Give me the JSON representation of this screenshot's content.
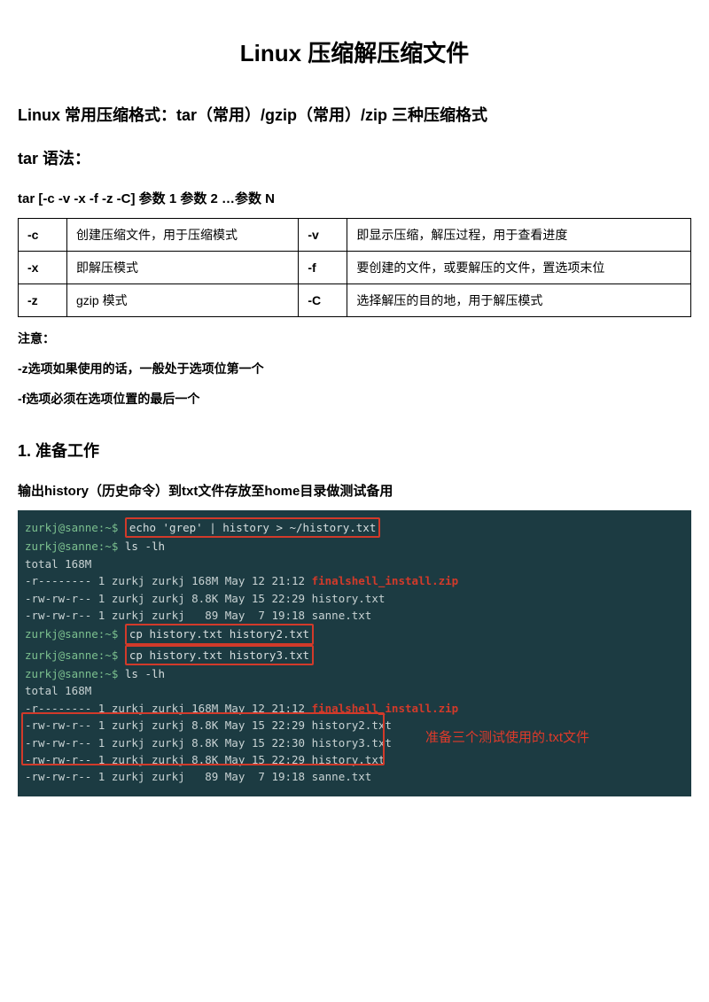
{
  "title": "Linux 压缩解压缩文件",
  "h_formats": "Linux 常用压缩格式：tar（常用）/gzip（常用）/zip 三种压缩格式",
  "h_syntax": "tar 语法：",
  "syntax_line": "tar [-c -v -x -f -z -C]  参数 1  参数 2 …参数 N",
  "table": {
    "r1c1": "-c",
    "r1c2": "创建压缩文件，用于压缩模式",
    "r1c3": "-v",
    "r1c4": "即显示压缩，解压过程，用于查看进度",
    "r2c1": "-x",
    "r2c2": "即解压模式",
    "r2c3": "-f",
    "r2c4": "要创建的文件，或要解压的文件，置选项末位",
    "r3c1": "-z",
    "r3c2": "gzip 模式",
    "r3c3": "-C",
    "r3c4": "选择解压的目的地，用于解压模式"
  },
  "note_head": "注意：",
  "note_z": "-z选项如果使用的话，一般处于选项位第一个",
  "note_f": "-f选项必须在选项位置的最后一个",
  "h_step1": "1.  准备工作",
  "step1_desc": "输出history（历史命令）到txt文件存放至home目录做测试备用",
  "term": {
    "p": "zurkj@sanne:~$",
    "l1_cmd": "echo 'grep' | history > ~/history.txt",
    "l2_cmd": "ls -lh",
    "l3": "total 168M",
    "l4a": "-r-------- 1 zurkj zurkj 168M May 12 21:12 ",
    "l4b": "finalshell_install.zip",
    "l5": "-rw-rw-r-- 1 zurkj zurkj 8.8K May 15 22:29 history.txt",
    "l6": "-rw-rw-r-- 1 zurkj zurkj   89 May  7 19:18 sanne.txt",
    "l7_cmd": "cp history.txt history2.txt",
    "l8_cmd": "cp history.txt history3.txt",
    "l9_cmd": "ls -lh",
    "l10": "total 168M",
    "l11a": "-r-------- 1 zurkj zurkj 168M May 12 21:12 ",
    "l11b": "finalshell_install.zip",
    "l12": "-rw-rw-r-- 1 zurkj zurkj 8.8K May 15 22:29 history2.txt",
    "l13": "-rw-rw-r-- 1 zurkj zurkj 8.8K May 15 22:30 history3.txt",
    "l14": "-rw-rw-r-- 1 zurkj zurkj 8.8K May 15 22:29 history.txt",
    "l15": "-rw-rw-r-- 1 zurkj zurkj   89 May  7 19:18 sanne.txt",
    "anno": "准备三个测试使用的.txt文件"
  }
}
